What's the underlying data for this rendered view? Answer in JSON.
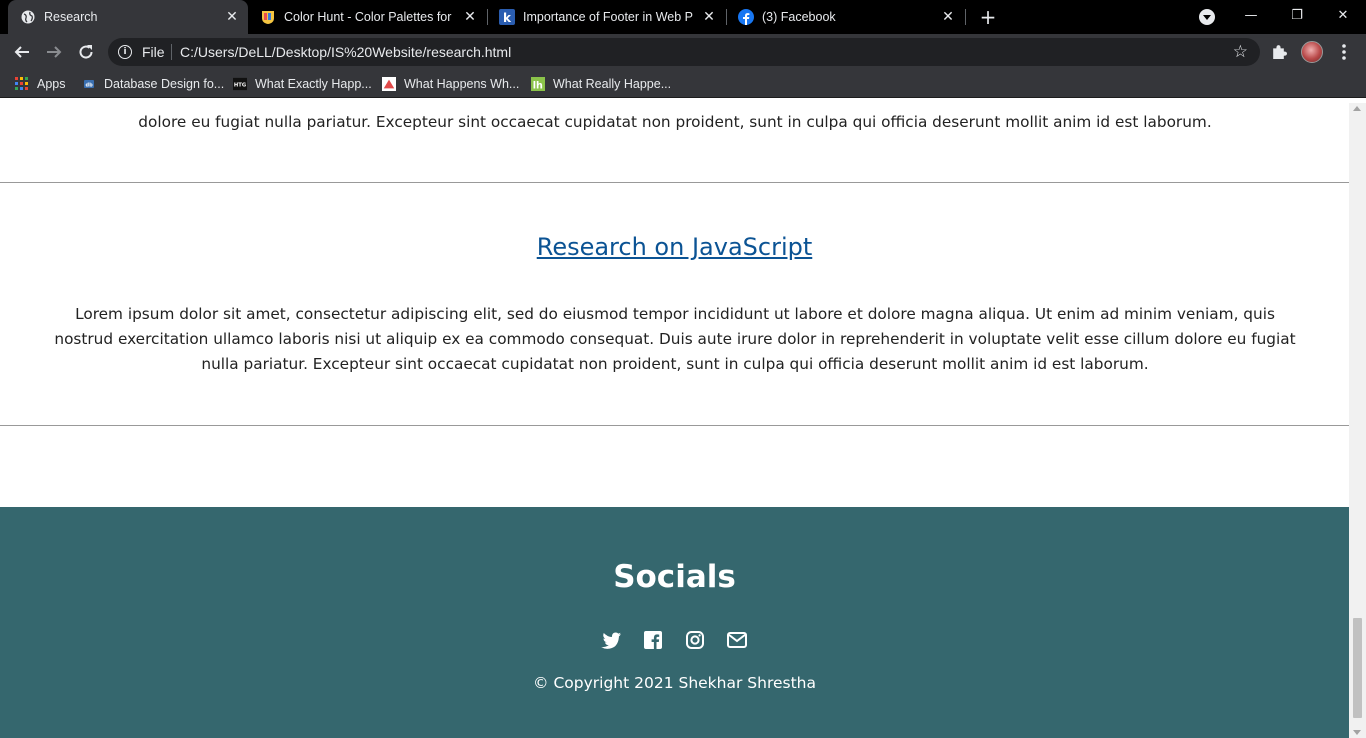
{
  "tabs": [
    {
      "title": "Research",
      "active": true
    },
    {
      "title": "Color Hunt - Color Palettes for De",
      "active": false
    },
    {
      "title": "Importance of Footer in Web Pag",
      "active": false
    },
    {
      "title": "(3) Facebook",
      "active": false
    }
  ],
  "window_controls": {
    "minimize": "—",
    "restore": "❐",
    "close": "✕"
  },
  "address_bar": {
    "scheme": "File",
    "url": "C:/Users/DeLL/Desktop/IS%20Website/research.html"
  },
  "bookmarks": [
    {
      "label": "Apps",
      "icon": "apps-grid-icon"
    },
    {
      "label": "Database Design fo...",
      "icon": "db-icon"
    },
    {
      "label": "What Exactly Happ...",
      "icon": "htg-icon"
    },
    {
      "label": "What Happens Wh...",
      "icon": "triangle-icon"
    },
    {
      "label": "What Really Happe...",
      "icon": "lh-icon"
    }
  ],
  "page": {
    "top_para_last_line": "dolore eu fugiat nulla pariatur. Excepteur sint occaecat cupidatat non proident, sunt in culpa qui officia deserunt mollit anim id est laborum.",
    "section": {
      "heading": "Research on JavaScript",
      "paragraph": "Lorem ipsum dolor sit amet, consectetur adipiscing elit, sed do eiusmod tempor incididunt ut labore et dolore magna aliqua. Ut enim ad minim veniam, quis nostrud exercitation ullamco laboris nisi ut aliquip ex ea commodo consequat. Duis aute irure dolor in reprehenderit in voluptate velit esse cillum dolore eu fugiat nulla pariatur. Excepteur sint occaecat cupidatat non proident, sunt in culpa qui officia deserunt mollit anim id est laborum."
    },
    "footer": {
      "title": "Socials",
      "icons": [
        "twitter-icon",
        "facebook-icon",
        "instagram-icon",
        "email-icon"
      ],
      "copyright": "© Copyright 2021 Shekhar Shrestha"
    }
  },
  "colors": {
    "footer_bg": "#35676e",
    "link": "#0b5394",
    "tab_active_bg": "#35363a",
    "tabstrip_bg": "#000000"
  }
}
